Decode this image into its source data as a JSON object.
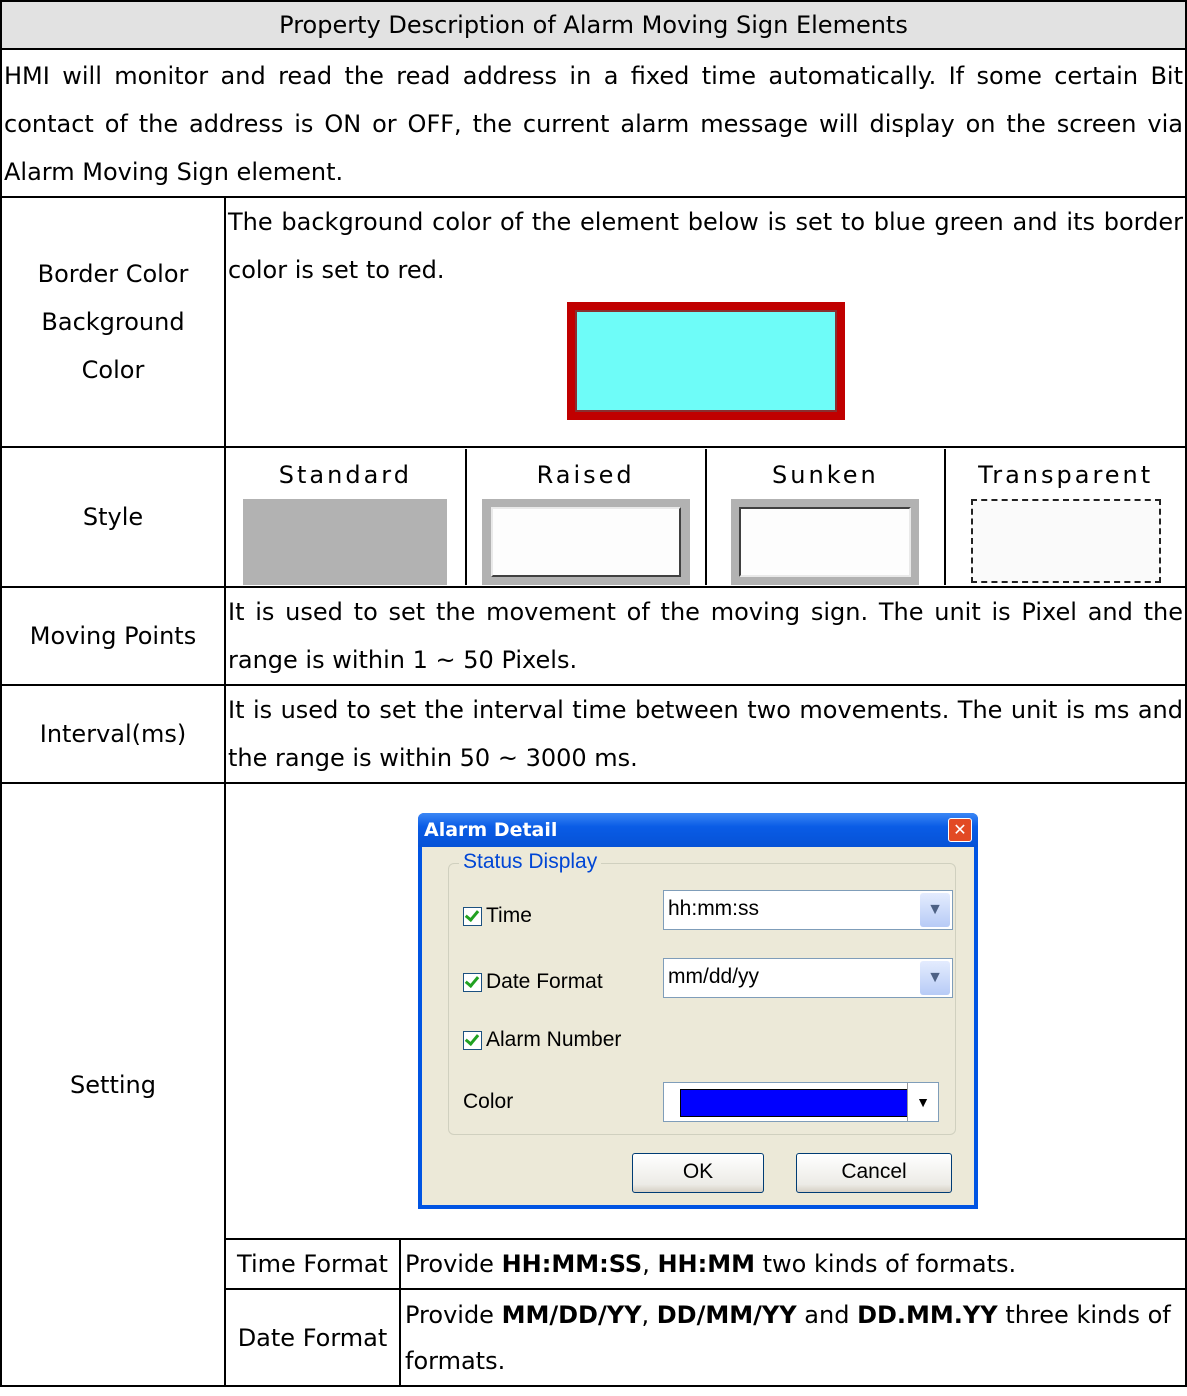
{
  "title": "Property Description of Alarm Moving Sign Elements",
  "intro": "HMI will monitor and read the read address in a fixed time automatically. If some certain Bit contact of the address is ON or OFF, the current alarm message will display on the screen via Alarm Moving Sign element.",
  "color_row": {
    "label_line1": "Border Color",
    "label_line2": "Background",
    "label_line3": "Color",
    "text": "The background color of the element below is set to blue green and its border color is set to red.",
    "demo_border": "#c00000",
    "demo_background": "#6efcf8"
  },
  "style_row": {
    "label": "Style",
    "styles": [
      "Standard",
      "Raised",
      "Sunken",
      "Transparent"
    ]
  },
  "moving_points": {
    "label": "Moving Points",
    "text": "It is used to set the movement of the moving sign. The unit is Pixel and the range is within 1 ~ 50 Pixels."
  },
  "interval": {
    "label": "Interval(ms)",
    "text": "It is used to set the interval time between two movements. The unit is ms and the range is within 50 ~ 3000 ms."
  },
  "setting": {
    "label": "Setting",
    "dialog": {
      "title": "Alarm Detail",
      "group_title": "Status Display",
      "time_label": "Time",
      "time_value": "hh:mm:ss",
      "date_label": "Date Format",
      "date_value": "mm/dd/yy",
      "alarm_number_label": "Alarm Number",
      "color_label": "Color",
      "color_value": "#0000ff",
      "ok": "OK",
      "cancel": "Cancel"
    },
    "time_format": {
      "label": "Time Format",
      "pre": "Provide ",
      "f1": "HH:MM:SS",
      "sep": ", ",
      "f2": "HH:MM",
      "post": " two kinds of formats."
    },
    "date_format": {
      "label": "Date Format",
      "pre": "Provide ",
      "f1": "MM/DD/YY",
      "sep1": ", ",
      "f2": "DD/MM/YY",
      "sep2": " and ",
      "f3": "DD.MM.YY",
      "post": " three kinds of formats."
    }
  }
}
